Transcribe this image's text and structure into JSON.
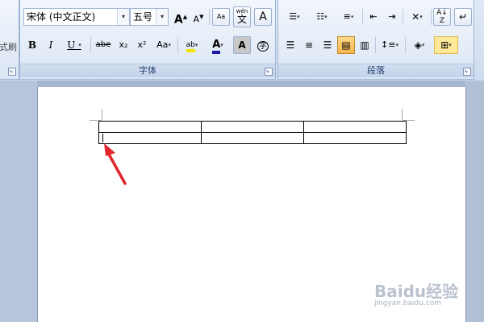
{
  "ribbon": {
    "partial_left_text": "式刷",
    "font_group": {
      "label": "字体",
      "font_name": "宋体 (中文正文)",
      "font_size": "五号",
      "grow_font_label": "A",
      "shrink_font_label": "A",
      "phonetic_label": "Aa",
      "enclosed_label": "A",
      "bold_label": "B",
      "italic_label": "I",
      "underline_label": "U",
      "strike_label": "abe",
      "subscript_label": "x₂",
      "superscript_label": "x²",
      "change_case_label": "Aa",
      "highlight_label": "ab",
      "font_color_label": "A",
      "char_shading_label": "A",
      "enclose_char_label": "字",
      "pinyin_top": "wén",
      "pinyin_char": "文"
    },
    "paragraph_group": {
      "label": "段落"
    },
    "colors": {
      "highlight": "#f2e600",
      "font_color": "#d0021b"
    }
  },
  "watermark": {
    "brand": "Baidu经验",
    "url": "jingyan.baidu.com"
  }
}
